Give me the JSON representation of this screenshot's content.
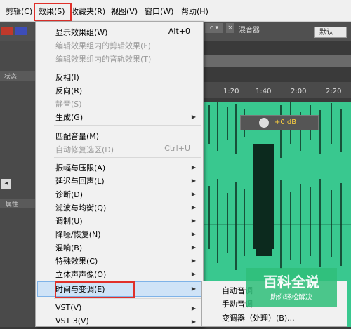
{
  "menubar": {
    "items": [
      "剪辑(C)",
      "效果(S)",
      "收藏夹(R)",
      "视图(V)",
      "窗口(W)",
      "帮助(H)"
    ]
  },
  "toolbar": {
    "workspace": "默认",
    "panel_tab": "混音器"
  },
  "left_panel": {
    "status_label": "状态",
    "prop_label": "属性"
  },
  "timeline": {
    "ticks": [
      "1:20",
      "1:40",
      "2:00",
      "2:20"
    ]
  },
  "hud": {
    "value": "+0 dB"
  },
  "effects_menu": {
    "items": [
      {
        "label": "显示效果组(W)",
        "shortcut": "Alt+0",
        "enabled": true
      },
      {
        "label": "编辑效果组内的剪辑效果(F)",
        "enabled": false
      },
      {
        "label": "编辑效果组内的音轨效果(T)",
        "enabled": false
      },
      {
        "label": "反相(I)",
        "enabled": true
      },
      {
        "label": "反向(R)",
        "enabled": true
      },
      {
        "label": "静音(S)",
        "enabled": false
      },
      {
        "label": "生成(G)",
        "enabled": true,
        "submenu": true
      },
      {
        "label": "匹配音量(M)",
        "enabled": true
      },
      {
        "label": "自动修复选区(D)",
        "shortcut": "Ctrl+U",
        "enabled": false
      },
      {
        "label": "振幅与压限(A)",
        "enabled": true,
        "submenu": true
      },
      {
        "label": "延迟与回声(L)",
        "enabled": true,
        "submenu": true
      },
      {
        "label": "诊断(D)",
        "enabled": true,
        "submenu": true
      },
      {
        "label": "滤波与均衡(Q)",
        "enabled": true,
        "submenu": true
      },
      {
        "label": "调制(U)",
        "enabled": true,
        "submenu": true
      },
      {
        "label": "降噪/恢复(N)",
        "enabled": true,
        "submenu": true
      },
      {
        "label": "混响(B)",
        "enabled": true,
        "submenu": true
      },
      {
        "label": "特殊效果(C)",
        "enabled": true,
        "submenu": true
      },
      {
        "label": "立体声声像(O)",
        "enabled": true,
        "submenu": true
      },
      {
        "label": "时间与变调(E)",
        "enabled": true,
        "submenu": true,
        "selected": true
      },
      {
        "label": "VST(V)",
        "enabled": true,
        "submenu": true
      },
      {
        "label": "VST 3(V)",
        "enabled": true,
        "submenu": true
      }
    ]
  },
  "time_submenu": {
    "items": [
      "自动音调",
      "手动音调",
      "变调器（处理）(B)..."
    ]
  },
  "watermark": {
    "title": "百科全说",
    "subtitle": "助你轻松解决"
  },
  "colors": {
    "waveform_bg": "#39c88f",
    "highlight": "#e0302a",
    "menu_bg": "#f1f1f1"
  }
}
